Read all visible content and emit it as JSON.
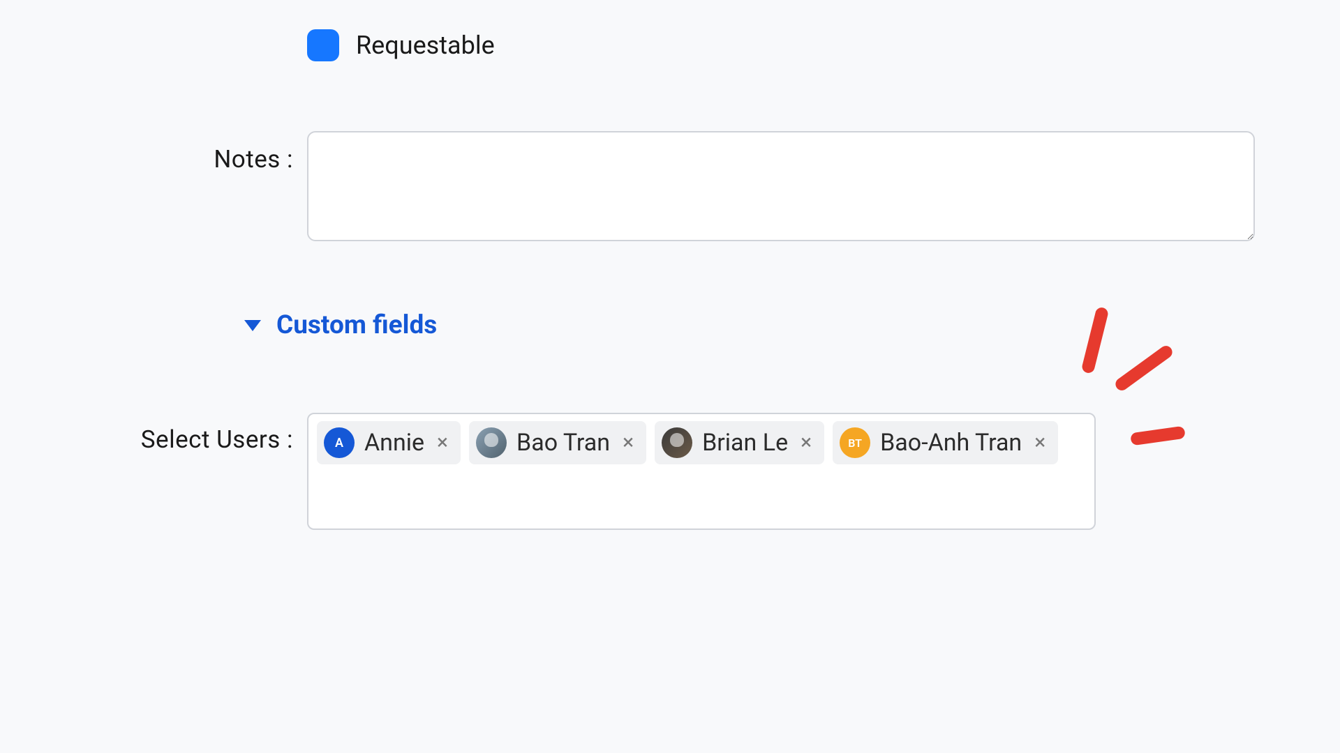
{
  "form": {
    "requestable": {
      "label": "Requestable",
      "checked": true
    },
    "notes": {
      "label": "Notes :",
      "value": ""
    },
    "custom_fields": {
      "header": "Custom fields",
      "expanded": true
    },
    "select_users": {
      "label": "Select Users :",
      "tags": [
        {
          "name": "Annie",
          "avatar_type": "initial",
          "avatar_text": "A",
          "avatar_color": "blue"
        },
        {
          "name": "Bao Tran",
          "avatar_type": "photo",
          "avatar_text": "",
          "avatar_color": "photo1"
        },
        {
          "name": "Brian Le",
          "avatar_type": "photo",
          "avatar_text": "",
          "avatar_color": "photo2"
        },
        {
          "name": "Bao-Anh Tran",
          "avatar_type": "initial",
          "avatar_text": "BT",
          "avatar_color": "orange"
        }
      ]
    }
  },
  "annotation": {
    "present": true,
    "color": "#e63a2e"
  }
}
